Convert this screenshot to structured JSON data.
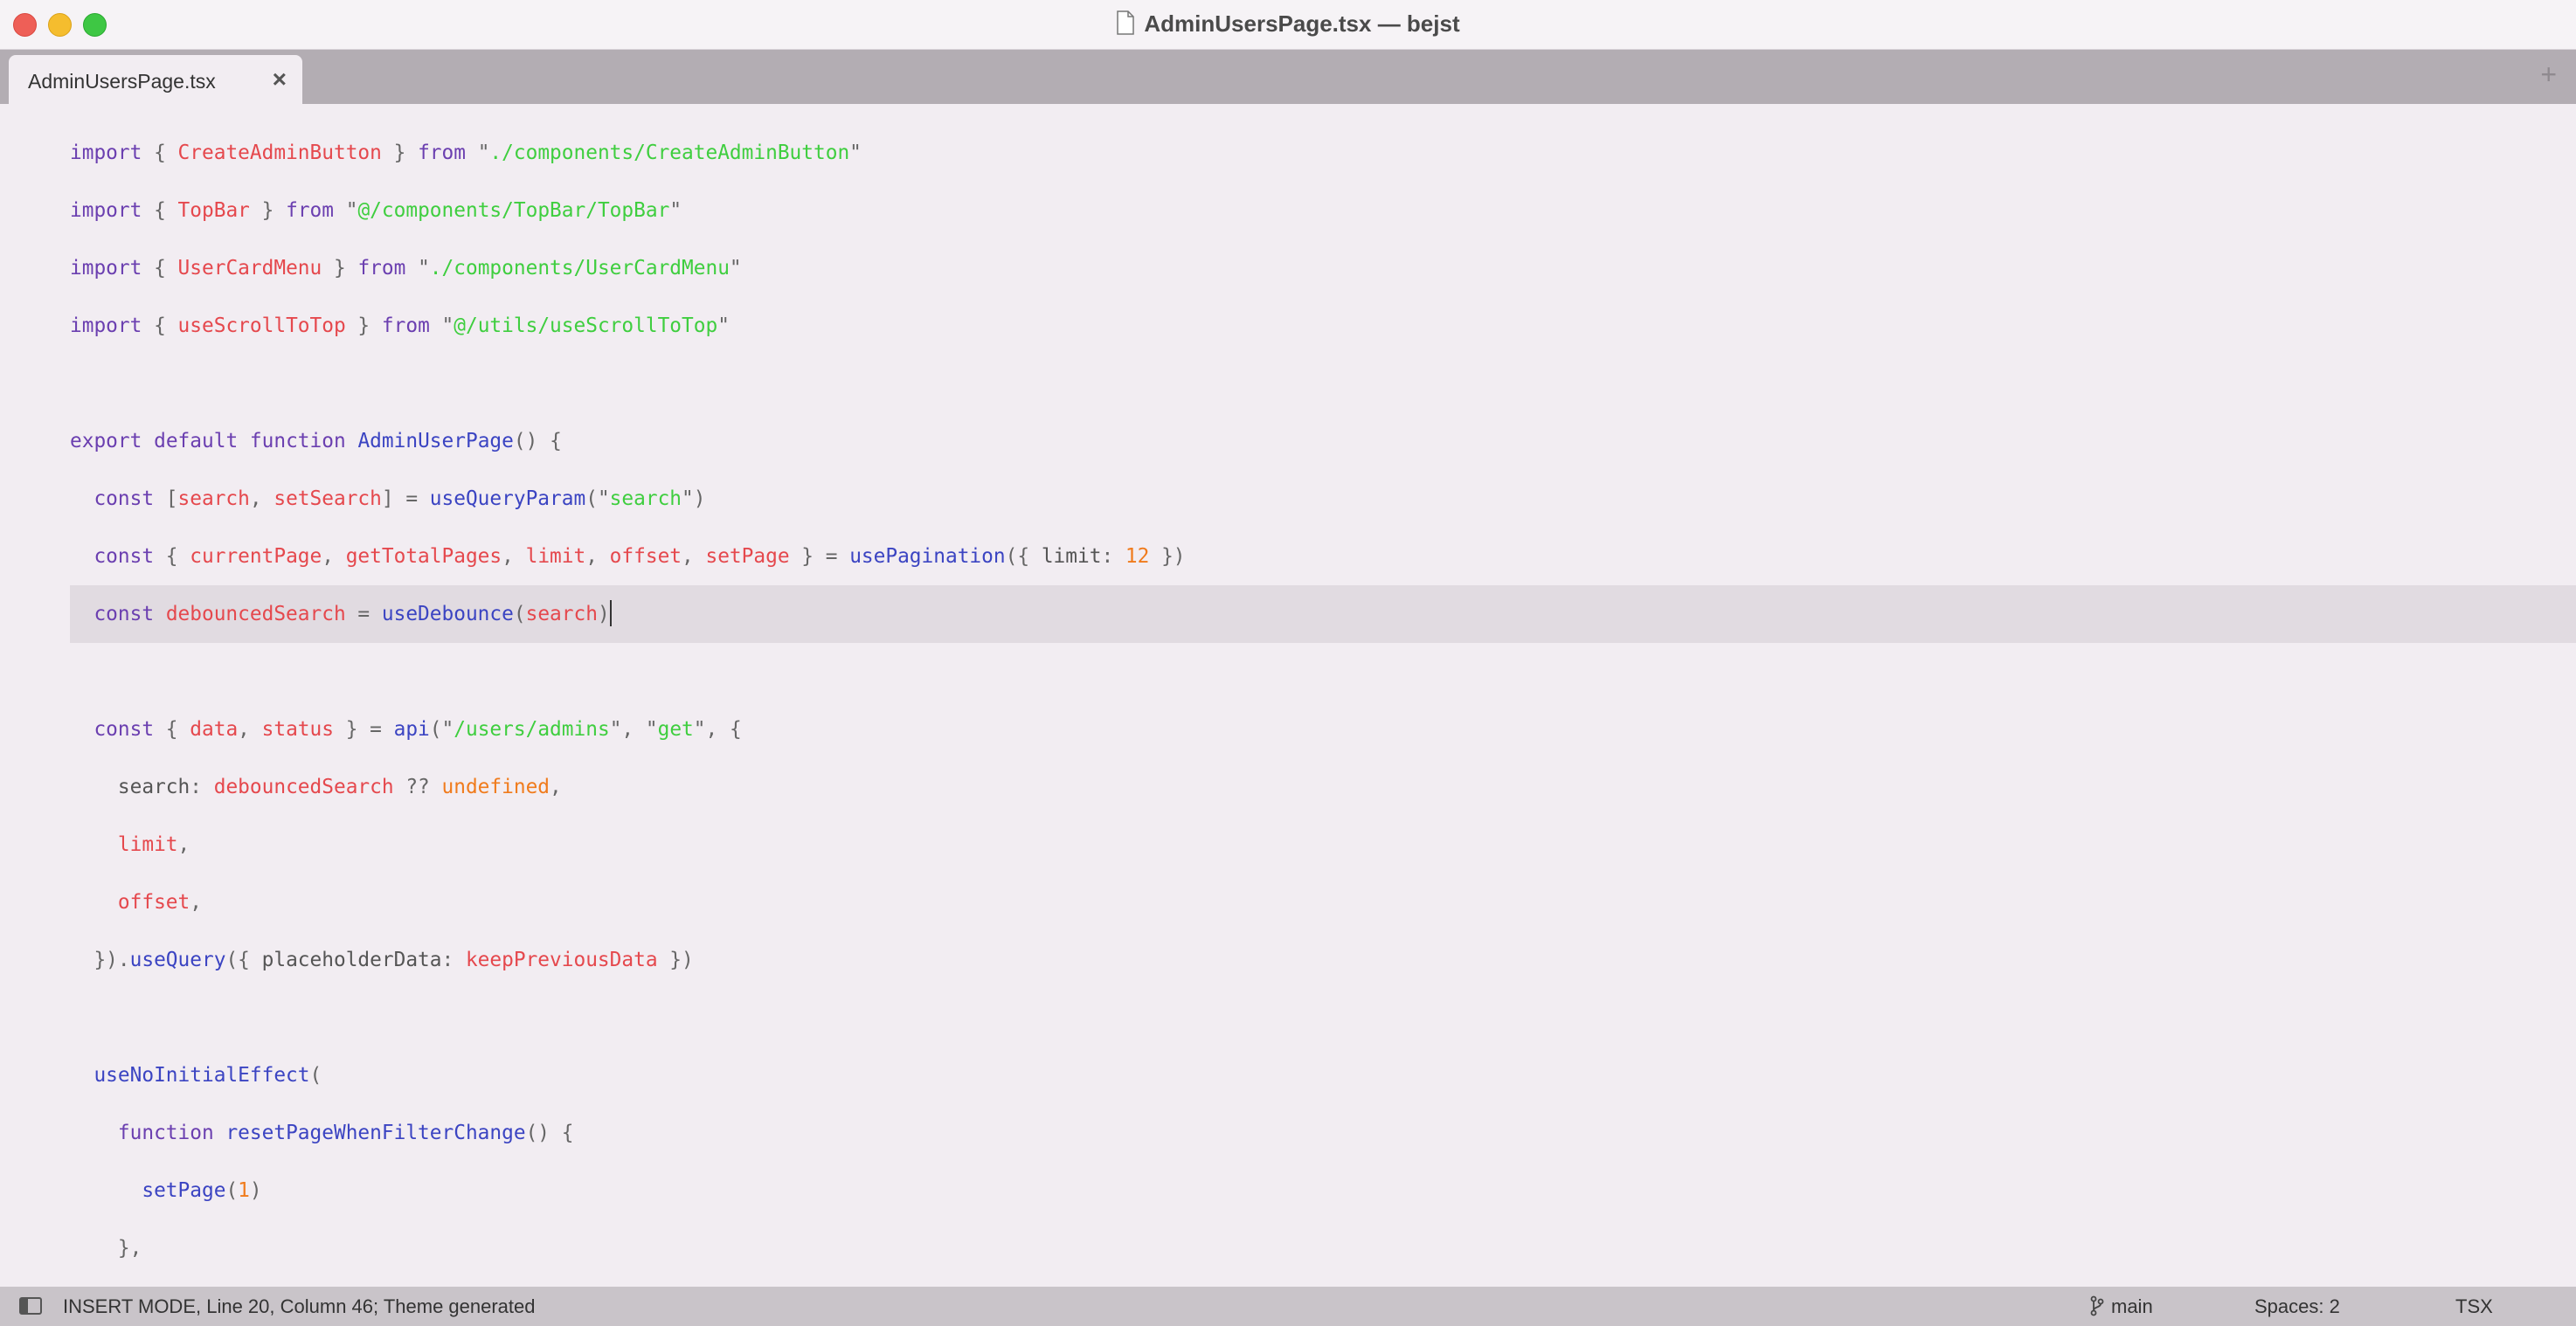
{
  "window": {
    "title": "AdminUsersPage.tsx — bejst"
  },
  "tabs": [
    {
      "label": "AdminUsersPage.tsx",
      "close": "×"
    }
  ],
  "tabbar": {
    "add": "+"
  },
  "editor": {
    "lines": [
      [
        [
          "kw",
          "import"
        ],
        [
          "p",
          " { "
        ],
        [
          "id",
          "CreateAdminButton"
        ],
        [
          "p",
          " } "
        ],
        [
          "kw",
          "from"
        ],
        [
          "p",
          " \""
        ],
        [
          "str",
          "./components/CreateAdminButton"
        ],
        [
          "p",
          "\""
        ]
      ],
      [
        [
          "kw",
          "import"
        ],
        [
          "p",
          " { "
        ],
        [
          "id",
          "TopBar"
        ],
        [
          "p",
          " } "
        ],
        [
          "kw",
          "from"
        ],
        [
          "p",
          " \""
        ],
        [
          "str",
          "@/components/TopBar/TopBar"
        ],
        [
          "p",
          "\""
        ]
      ],
      [
        [
          "kw",
          "import"
        ],
        [
          "p",
          " { "
        ],
        [
          "id",
          "UserCardMenu"
        ],
        [
          "p",
          " } "
        ],
        [
          "kw",
          "from"
        ],
        [
          "p",
          " \""
        ],
        [
          "str",
          "./components/UserCardMenu"
        ],
        [
          "p",
          "\""
        ]
      ],
      [
        [
          "kw",
          "import"
        ],
        [
          "p",
          " { "
        ],
        [
          "id",
          "useScrollToTop"
        ],
        [
          "p",
          " } "
        ],
        [
          "kw",
          "from"
        ],
        [
          "p",
          " \""
        ],
        [
          "str",
          "@/utils/useScrollToTop"
        ],
        [
          "p",
          "\""
        ]
      ],
      [],
      [
        [
          "kw",
          "export"
        ],
        [
          "p",
          " "
        ],
        [
          "kw",
          "default"
        ],
        [
          "p",
          " "
        ],
        [
          "kw",
          "function"
        ],
        [
          "p",
          " "
        ],
        [
          "fn",
          "AdminUserPage"
        ],
        [
          "p",
          "() {"
        ]
      ],
      [
        [
          "p",
          "  "
        ],
        [
          "kw",
          "const"
        ],
        [
          "p",
          " ["
        ],
        [
          "id",
          "search"
        ],
        [
          "p",
          ", "
        ],
        [
          "id",
          "setSearch"
        ],
        [
          "p",
          "] = "
        ],
        [
          "fn",
          "useQueryParam"
        ],
        [
          "p",
          "(\""
        ],
        [
          "str",
          "search"
        ],
        [
          "p",
          "\")"
        ]
      ],
      [
        [
          "p",
          "  "
        ],
        [
          "kw",
          "const"
        ],
        [
          "p",
          " { "
        ],
        [
          "id",
          "currentPage"
        ],
        [
          "p",
          ", "
        ],
        [
          "id",
          "getTotalPages"
        ],
        [
          "p",
          ", "
        ],
        [
          "id",
          "limit"
        ],
        [
          "p",
          ", "
        ],
        [
          "id",
          "offset"
        ],
        [
          "p",
          ", "
        ],
        [
          "id",
          "setPage"
        ],
        [
          "p",
          " } = "
        ],
        [
          "fn",
          "usePagination"
        ],
        [
          "p",
          "({ "
        ],
        [
          "dim",
          "limit"
        ],
        [
          "p",
          ": "
        ],
        [
          "num",
          "12"
        ],
        [
          "p",
          " })"
        ]
      ],
      [
        [
          "p",
          "  "
        ],
        [
          "kw",
          "const"
        ],
        [
          "p",
          " "
        ],
        [
          "id",
          "debouncedSearch"
        ],
        [
          "p",
          " = "
        ],
        [
          "fn",
          "useDebounce"
        ],
        [
          "p",
          "("
        ],
        [
          "id",
          "search"
        ],
        [
          "p",
          ")"
        ]
      ],
      [],
      [
        [
          "p",
          "  "
        ],
        [
          "kw",
          "const"
        ],
        [
          "p",
          " { "
        ],
        [
          "id",
          "data"
        ],
        [
          "p",
          ", "
        ],
        [
          "id",
          "status"
        ],
        [
          "p",
          " } = "
        ],
        [
          "fn",
          "api"
        ],
        [
          "p",
          "(\""
        ],
        [
          "str",
          "/users/admins"
        ],
        [
          "p",
          "\", \""
        ],
        [
          "str",
          "get"
        ],
        [
          "p",
          "\", {"
        ]
      ],
      [
        [
          "p",
          "    "
        ],
        [
          "dim",
          "search"
        ],
        [
          "p",
          ": "
        ],
        [
          "id",
          "debouncedSearch"
        ],
        [
          "p",
          " ?? "
        ],
        [
          "num",
          "undefined"
        ],
        [
          "p",
          ","
        ]
      ],
      [
        [
          "p",
          "    "
        ],
        [
          "id",
          "limit"
        ],
        [
          "p",
          ","
        ]
      ],
      [
        [
          "p",
          "    "
        ],
        [
          "id",
          "offset"
        ],
        [
          "p",
          ","
        ]
      ],
      [
        [
          "p",
          "  })."
        ],
        [
          "fn",
          "useQuery"
        ],
        [
          "p",
          "({ "
        ],
        [
          "dim",
          "placeholderData"
        ],
        [
          "p",
          ": "
        ],
        [
          "id",
          "keepPreviousData"
        ],
        [
          "p",
          " })"
        ]
      ],
      [],
      [
        [
          "p",
          "  "
        ],
        [
          "fn",
          "useNoInitialEffect"
        ],
        [
          "p",
          "("
        ]
      ],
      [
        [
          "p",
          "    "
        ],
        [
          "kw",
          "function"
        ],
        [
          "p",
          " "
        ],
        [
          "fn",
          "resetPageWhenFilterChange"
        ],
        [
          "p",
          "() {"
        ]
      ],
      [
        [
          "p",
          "      "
        ],
        [
          "fn",
          "setPage"
        ],
        [
          "p",
          "("
        ],
        [
          "num",
          "1"
        ],
        [
          "p",
          ")"
        ]
      ],
      [
        [
          "p",
          "    },"
        ]
      ]
    ],
    "current_line_index": 8
  },
  "status": {
    "mode": "INSERT MODE, Line 20, Column 46; Theme generated",
    "branch": "main",
    "spaces": "Spaces: 2",
    "syntax": "TSX"
  },
  "colors": {
    "keyword": "#6b3fb0",
    "identifier": "#e5484d",
    "function": "#3b44c2",
    "string": "#3fce3f",
    "number": "#f07b1c",
    "editor_bg": "#f2edf2",
    "current_line_bg": "#e1dbe1",
    "tabbar_bg": "#b3adb3",
    "statusbar_bg": "#c9c4c9"
  },
  "icons": {
    "file": "document-icon",
    "branch": "git-branch-icon",
    "sidebar": "sidebar-toggle-icon"
  }
}
